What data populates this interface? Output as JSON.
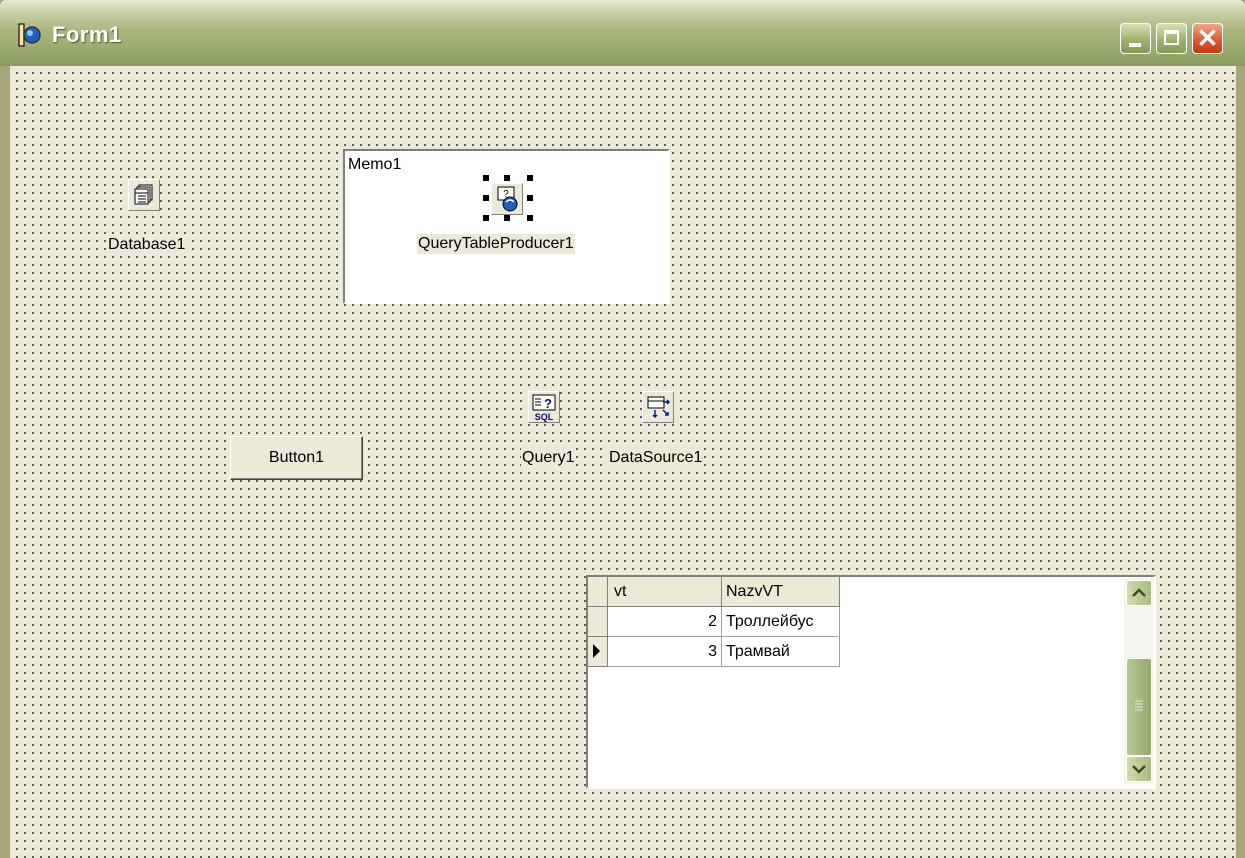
{
  "window": {
    "title": "Form1",
    "icon": "delphi-app-icon",
    "controls": {
      "minimize": "minimize-icon",
      "maximize": "maximize-icon",
      "close": "close-icon"
    }
  },
  "form": {
    "components": {
      "database": {
        "label": "Database1",
        "icon": "database-icon"
      },
      "query": {
        "label": "Query1",
        "icon": "sql-query-icon"
      },
      "datasource": {
        "label": "DataSource1",
        "icon": "datasource-icon"
      },
      "producer": {
        "label": "QueryTableProducer1",
        "icon": "query-table-producer-icon"
      }
    },
    "memo": {
      "text": "Memo1"
    },
    "button": {
      "label": "Button1"
    },
    "grid": {
      "columns": [
        "vt",
        "NazvVT"
      ],
      "rows": [
        {
          "vt": "2",
          "name": "Троллейбус"
        },
        {
          "vt": "3",
          "name": "Трамвай"
        }
      ],
      "current_row_indicator": "triangle-right-icon"
    }
  },
  "colors": {
    "form_background": "#ece9d8",
    "titlebar": "#a9b57b",
    "close_button": "#de5a32"
  }
}
